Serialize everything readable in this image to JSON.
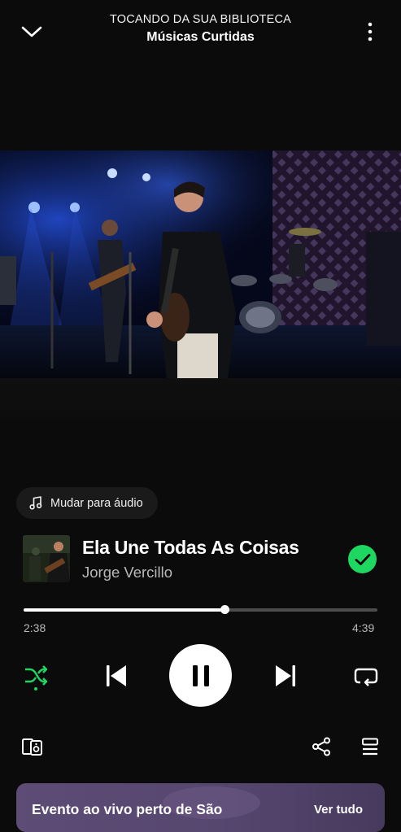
{
  "header": {
    "context_label": "TOCANDO DA SUA BIBLIOTECA",
    "context_title": "Músicas Curtidas"
  },
  "switch_mode": {
    "label": "Mudar para áudio"
  },
  "track": {
    "title": "Ela Une Todas As Coisas",
    "artist": "Jorge Vercillo",
    "liked": true
  },
  "progress": {
    "elapsed": "2:38",
    "total": "4:39",
    "fraction": 0.57
  },
  "controls": {
    "shuffle_active": true,
    "state": "playing"
  },
  "bottom_card": {
    "title": "Evento ao vivo perto de São",
    "action": "Ver tudo"
  },
  "colors": {
    "accent": "#1ed760",
    "background": "#0b0b0b",
    "card": "#5d4c75"
  }
}
